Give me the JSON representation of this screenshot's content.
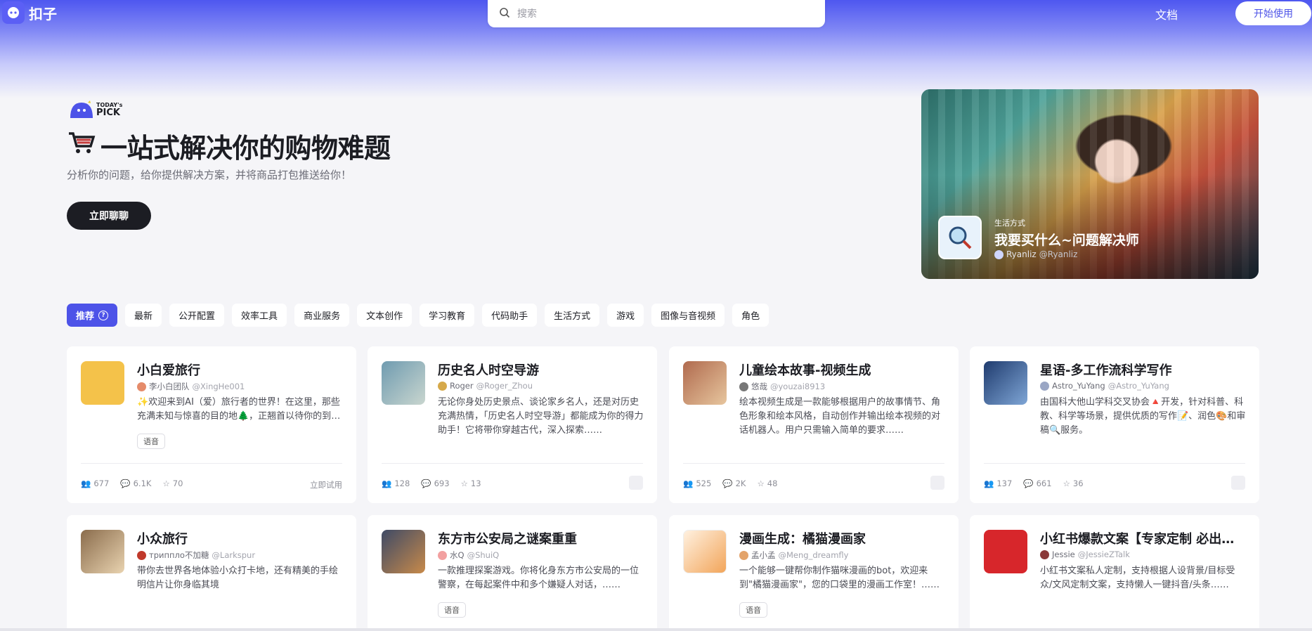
{
  "app": {
    "name": "扣子"
  },
  "search": {
    "placeholder": "搜索"
  },
  "nav": {
    "docs": "文档",
    "start": "开始使用"
  },
  "hero": {
    "badge_small": "TODAY's",
    "badge_big": "PICK",
    "title": "一站式解决你的购物难题",
    "subtitle": "分析你的问题，给你提供解决方案，并将商品打包推送给你！",
    "cta": "立即聊聊"
  },
  "banner": {
    "category": "生活方式",
    "title": "我要买什么~问题解决师",
    "author": "Ryanliz",
    "handle": "@Ryanliz"
  },
  "tabs": [
    {
      "label": "推荐"
    },
    {
      "label": "最新"
    },
    {
      "label": "公开配置"
    },
    {
      "label": "效率工具"
    },
    {
      "label": "商业服务"
    },
    {
      "label": "文本创作"
    },
    {
      "label": "学习教育"
    },
    {
      "label": "代码助手"
    },
    {
      "label": "生活方式"
    },
    {
      "label": "游戏"
    },
    {
      "label": "图像与音视频"
    },
    {
      "label": "角色"
    }
  ],
  "cards": [
    {
      "title": "小白爱旅行",
      "author": "李小白团队",
      "handle": "@XingHe001",
      "desc": "✨欢迎来到AI（爱）旅行者的世界！在这里，那些充满未知与惊喜的目的地🌲，正翘首以待你的到来……",
      "tag": "语音",
      "users": "677",
      "comments": "6.1K",
      "stars": "70",
      "try": "立即试用",
      "color": "#f4c24a"
    },
    {
      "title": "历史名人时空导游",
      "author": "Roger",
      "handle": "@Roger_Zhou",
      "desc": "无论你身处历史景点、谈论家乡名人，还是对历史充满热情，「历史名人时空导游」都能成为你的得力助手！它将带你穿越古代，深入探索……",
      "users": "128",
      "comments": "693",
      "stars": "13",
      "color": "#6f9bb0"
    },
    {
      "title": "儿童绘本故事-视频生成",
      "author": "悠哉",
      "handle": "@youzai8913",
      "desc": "绘本视频生成是一款能够根据用户的故事情节、角色形象和绘本风格，自动创作并输出绘本视频的对话机器人。用户只需输入简单的要求……",
      "users": "525",
      "comments": "2K",
      "stars": "48",
      "color": "#b06a4e"
    },
    {
      "title": "星语-多工作流科学写作",
      "author": "Astro_YuYang",
      "handle": "@Astro_YuYang",
      "desc": "由国科大他山学科交叉协会🔺开发，针对科普、科教、科学等场景，提供优质的写作📝、润色🎨和审稿🔍服务。",
      "users": "137",
      "comments": "661",
      "stars": "36",
      "color": "#1f3b6e"
    },
    {
      "title": "小众旅行",
      "author": "триппло不加糖",
      "handle": "@Larkspur",
      "desc": "带你去世界各地体验小众打卡地，还有精美的手绘明信片让你身临其境",
      "color": "#8a6c4c"
    },
    {
      "title": "东方市公安局之谜案重重",
      "author": "水Q",
      "handle": "@ShuiQ",
      "desc": "一款推理探案游戏。你将化身东方市公安局的一位警察，在每起案件中和多个嫌疑人对话，……",
      "tag": "语音",
      "color": "#3e4a66"
    },
    {
      "title": "漫画生成：橘猫漫画家",
      "author": "孟小孟",
      "handle": "@Meng_dreamfly",
      "desc": "一个能够一键帮你制作猫咪漫画的bot，欢迎来到\"橘猫漫画家\"，您的口袋里的漫画工作室！……",
      "tag": "语音",
      "color": "#f2a55a"
    },
    {
      "title": "小红书爆款文案【专家定制 必出爆款】",
      "author": "Jessie",
      "handle": "@JessieZTalk",
      "desc": "小红书文案私人定制，支持根据人设背景/目标受众/文风定制文案，支持懒人一键抖音/头条……",
      "color": "#d7262b"
    }
  ],
  "colors": {
    "accent": "#4d53e8",
    "dark": "#1c1d23"
  }
}
